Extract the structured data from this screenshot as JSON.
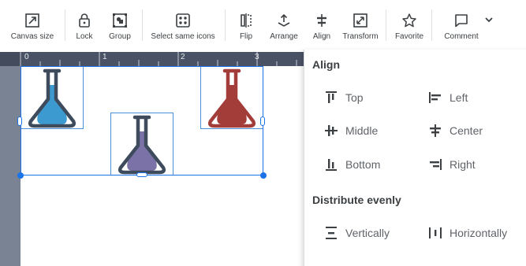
{
  "toolbar": {
    "canvas_size": {
      "label": "Canvas size",
      "icon": "resize-icon"
    },
    "lock": {
      "label": "Lock",
      "icon": "lock-icon"
    },
    "group": {
      "label": "Group",
      "icon": "group-icon"
    },
    "select_same": {
      "label": "Select same icons",
      "icon": "select-same-icon"
    },
    "flip": {
      "label": "Flip",
      "icon": "flip-icon"
    },
    "arrange": {
      "label": "Arrange",
      "icon": "arrange-icon"
    },
    "align": {
      "label": "Align",
      "icon": "align-icon"
    },
    "transform": {
      "label": "Transform",
      "icon": "transform-icon"
    },
    "favorite": {
      "label": "Favorite",
      "icon": "star-icon"
    },
    "comment": {
      "label": "Comment",
      "icon": "comment-icon"
    },
    "more": {
      "icon": "chevron-down-icon"
    }
  },
  "ruler": {
    "ticks": [
      "0",
      "1",
      "2",
      "3"
    ]
  },
  "canvas": {
    "flasks": [
      {
        "name": "blue-flask-icon",
        "fill": "#3d9ad1"
      },
      {
        "name": "purple-flask-icon",
        "fill": "#7b72a8"
      },
      {
        "name": "red-flask-icon",
        "fill": "#a33d3a"
      }
    ],
    "outline_color": "#3d4b5c",
    "selection_color": "#1a73e8"
  },
  "align_panel": {
    "title": "Align",
    "options": {
      "top": "Top",
      "left": "Left",
      "middle": "Middle",
      "center": "Center",
      "bottom": "Bottom",
      "right": "Right"
    },
    "distribute_title": "Distribute evenly",
    "distribute": {
      "vertically": "Vertically",
      "horizontally": "Horizontally"
    }
  }
}
